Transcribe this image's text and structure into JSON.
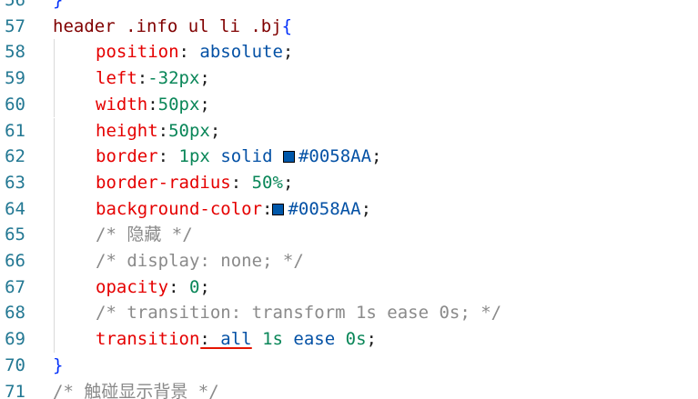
{
  "editor": {
    "lines": [
      {
        "n": "56",
        "parts": [
          {
            "t": "}",
            "c": "tok-brace"
          }
        ]
      },
      {
        "n": "57",
        "parts": [
          {
            "t": "header .info ul li .bj",
            "c": "tok-sel"
          },
          {
            "t": "{",
            "c": "tok-brace"
          }
        ]
      },
      {
        "n": "58",
        "indent": 1,
        "parts": [
          {
            "t": "position",
            "c": "tok-prop"
          },
          {
            "t": ": ",
            "c": "tok-punct"
          },
          {
            "t": "absolute",
            "c": "tok-val"
          },
          {
            "t": ";",
            "c": "tok-punct"
          }
        ]
      },
      {
        "n": "59",
        "indent": 1,
        "parts": [
          {
            "t": "left",
            "c": "tok-prop"
          },
          {
            "t": ":",
            "c": "tok-punct"
          },
          {
            "t": "-32px",
            "c": "tok-num"
          },
          {
            "t": ";",
            "c": "tok-punct"
          }
        ]
      },
      {
        "n": "60",
        "indent": 1,
        "parts": [
          {
            "t": "width",
            "c": "tok-prop"
          },
          {
            "t": ":",
            "c": "tok-punct"
          },
          {
            "t": "50px",
            "c": "tok-num"
          },
          {
            "t": ";",
            "c": "tok-punct"
          }
        ]
      },
      {
        "n": "61",
        "indent": 1,
        "parts": [
          {
            "t": "height",
            "c": "tok-prop"
          },
          {
            "t": ":",
            "c": "tok-punct"
          },
          {
            "t": "50px",
            "c": "tok-num"
          },
          {
            "t": ";",
            "c": "tok-punct"
          }
        ]
      },
      {
        "n": "62",
        "indent": 1,
        "parts": [
          {
            "t": "border",
            "c": "tok-prop"
          },
          {
            "t": ": ",
            "c": "tok-punct"
          },
          {
            "t": "1px",
            "c": "tok-num"
          },
          {
            "t": " ",
            "c": "tok-punct"
          },
          {
            "t": "solid",
            "c": "tok-val"
          },
          {
            "t": " ",
            "c": "tok-punct"
          },
          {
            "swatch": "#0058AA"
          },
          {
            "t": "#0058AA",
            "c": "tok-val"
          },
          {
            "t": ";",
            "c": "tok-punct"
          }
        ]
      },
      {
        "n": "63",
        "indent": 1,
        "parts": [
          {
            "t": "border-radius",
            "c": "tok-prop"
          },
          {
            "t": ": ",
            "c": "tok-punct"
          },
          {
            "t": "50%",
            "c": "tok-num"
          },
          {
            "t": ";",
            "c": "tok-punct"
          }
        ]
      },
      {
        "n": "64",
        "indent": 1,
        "parts": [
          {
            "t": "background-color",
            "c": "tok-prop"
          },
          {
            "t": ":",
            "c": "tok-punct"
          },
          {
            "swatch": "#0058AA"
          },
          {
            "t": "#0058AA",
            "c": "tok-val"
          },
          {
            "t": ";",
            "c": "tok-punct"
          }
        ]
      },
      {
        "n": "65",
        "indent": 1,
        "parts": [
          {
            "t": "/* 隐藏 */",
            "c": "tok-comment"
          }
        ]
      },
      {
        "n": "66",
        "indent": 1,
        "parts": [
          {
            "t": "/* display: none; */",
            "c": "tok-comment"
          }
        ]
      },
      {
        "n": "67",
        "indent": 1,
        "parts": [
          {
            "t": "opacity",
            "c": "tok-prop"
          },
          {
            "t": ": ",
            "c": "tok-punct"
          },
          {
            "t": "0",
            "c": "tok-num"
          },
          {
            "t": ";",
            "c": "tok-punct"
          }
        ]
      },
      {
        "n": "68",
        "indent": 1,
        "parts": [
          {
            "t": "/* transition: transform 1s ease 0s; */",
            "c": "tok-comment"
          }
        ]
      },
      {
        "n": "69",
        "indent": 1,
        "parts": [
          {
            "t": "transition",
            "c": "tok-prop"
          },
          {
            "t": ": ",
            "c": "tok-punct"
          },
          {
            "t": "all",
            "c": "tok-val",
            "err": true
          },
          {
            "t": " ",
            "c": "tok-punct"
          },
          {
            "t": "1s",
            "c": "tok-num"
          },
          {
            "t": " ",
            "c": "tok-punct"
          },
          {
            "t": "ease",
            "c": "tok-val"
          },
          {
            "t": " ",
            "c": "tok-punct"
          },
          {
            "t": "0s",
            "c": "tok-num"
          },
          {
            "t": ";",
            "c": "tok-punct"
          }
        ]
      },
      {
        "n": "70",
        "parts": [
          {
            "t": "}",
            "c": "tok-brace"
          }
        ]
      },
      {
        "n": "71",
        "parts": [
          {
            "t": "/* 触碰显示背景 */",
            "c": "tok-comment"
          }
        ]
      }
    ],
    "colors": {
      "line_number": "#237893",
      "selector": "#800000",
      "property": "#e50000",
      "value": "#0451a5",
      "number": "#098658",
      "comment": "#8a8a8a",
      "brace": "#0431fa",
      "error_squiggle": "#e51400"
    }
  }
}
